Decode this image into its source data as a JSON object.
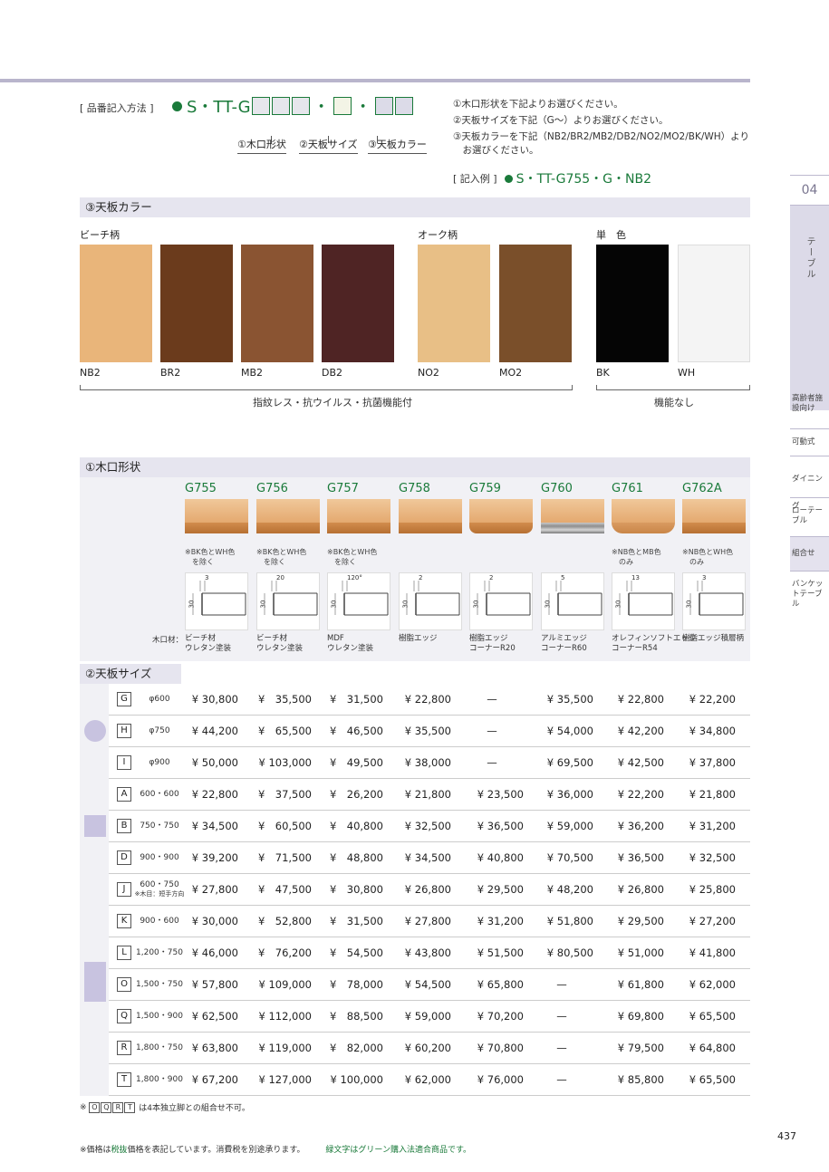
{
  "order": {
    "label": "[ 品番記入方法 ]",
    "code_prefix": "S・TT-G",
    "sep": "・",
    "part1": "①木口形状",
    "part2": "②天板サイズ",
    "part3": "③天板カラー"
  },
  "instructions": [
    "①木口形状を下記よりお選びください。",
    "②天板サイズを下記（G〜）よりお選びください。",
    "③天板カラーを下記（NB2/BR2/MB2/DB2/NO2/MO2/BK/WH）より",
    "　お選びください。"
  ],
  "example": {
    "label": "[ 記入例 ]",
    "code": "S・TT-G755・G・NB2"
  },
  "side": {
    "number": "04",
    "main": "テーブル",
    "items": [
      "高齢者施設向け",
      "可動式",
      "ダイニング",
      "ローテーブル",
      "組合せ",
      "バンケットテーブル"
    ]
  },
  "color_section": {
    "title": "③天板カラー",
    "groups": [
      "ビーチ柄",
      "オーク柄",
      "単　色"
    ],
    "swatches": [
      {
        "name": "NB2",
        "color": "#e9b57a"
      },
      {
        "name": "BR2",
        "color": "#6b3b1c"
      },
      {
        "name": "MB2",
        "color": "#8a5432"
      },
      {
        "name": "DB2",
        "color": "#4f2424"
      },
      {
        "name": "NO2",
        "color": "#e8bf86"
      },
      {
        "name": "MO2",
        "color": "#7a4f2a"
      },
      {
        "name": "BK",
        "color": "#050505"
      },
      {
        "name": "WH",
        "color": "#f4f4f4"
      }
    ],
    "feature1": "指紋レス・抗ウイルス・抗菌機能付",
    "feature2": "機能なし"
  },
  "edge_section": {
    "title": "①木口形状",
    "material_label": "木口材：",
    "edges": [
      {
        "code": "G755",
        "note": "※BK色とWH色\n　を除く",
        "dim": "3",
        "material": "ビーチ材\nウレタン塗装"
      },
      {
        "code": "G756",
        "note": "※BK色とWH色\n　を除く",
        "dim": "20",
        "material": "ビーチ材\nウレタン塗装"
      },
      {
        "code": "G757",
        "note": "※BK色とWH色\n　を除く",
        "dim": "120°",
        "material": "MDF\nウレタン塗装"
      },
      {
        "code": "G758",
        "note": "",
        "dim": "2",
        "material": "樹脂エッジ"
      },
      {
        "code": "G759",
        "note": "",
        "dim": "2",
        "material": "樹脂エッジ\nコーナーR20"
      },
      {
        "code": "G760",
        "note": "",
        "dim": "5",
        "material": "アルミエッジ\nコーナーR60"
      },
      {
        "code": "G761",
        "note": "※NB色とMB色\n　のみ",
        "dim": "13",
        "material": "オレフィンソフトエッジ\nコーナーR54"
      },
      {
        "code": "G762A",
        "note": "※NB色とWH色\n　のみ",
        "dim": "3",
        "material": "樹脂エッジ積層柄"
      }
    ],
    "height": "30"
  },
  "size_section": {
    "title": "②天板サイズ",
    "dash": "—",
    "rows": [
      {
        "code": "G",
        "size": "φ600",
        "prices": [
          "¥ 30,800",
          "¥　35,500",
          "¥　31,500",
          "¥ 22,800",
          "—",
          "¥ 35,500",
          "¥ 22,800",
          "¥ 22,200"
        ]
      },
      {
        "code": "H",
        "size": "φ750",
        "prices": [
          "¥ 44,200",
          "¥　65,500",
          "¥　46,500",
          "¥ 35,500",
          "—",
          "¥ 54,000",
          "¥ 42,200",
          "¥ 34,800"
        ]
      },
      {
        "code": "I",
        "size": "φ900",
        "prices": [
          "¥ 50,000",
          "¥ 103,000",
          "¥　49,500",
          "¥ 38,000",
          "—",
          "¥ 69,500",
          "¥ 42,500",
          "¥ 37,800"
        ]
      },
      {
        "code": "A",
        "size": "600・600",
        "prices": [
          "¥ 22,800",
          "¥　37,500",
          "¥　26,200",
          "¥ 21,800",
          "¥ 23,500",
          "¥ 36,000",
          "¥ 22,200",
          "¥ 21,800"
        ]
      },
      {
        "code": "B",
        "size": "750・750",
        "prices": [
          "¥ 34,500",
          "¥　60,500",
          "¥　40,800",
          "¥ 32,500",
          "¥ 36,500",
          "¥ 59,000",
          "¥ 36,200",
          "¥ 31,200"
        ]
      },
      {
        "code": "D",
        "size": "900・900",
        "prices": [
          "¥ 39,200",
          "¥　71,500",
          "¥　48,800",
          "¥ 34,500",
          "¥ 40,800",
          "¥ 70,500",
          "¥ 36,500",
          "¥ 32,500"
        ]
      },
      {
        "code": "J",
        "size": "600・750",
        "size_note": "※木目：短手方向",
        "prices": [
          "¥ 27,800",
          "¥　47,500",
          "¥　30,800",
          "¥ 26,800",
          "¥ 29,500",
          "¥ 48,200",
          "¥ 26,800",
          "¥ 25,800"
        ]
      },
      {
        "code": "K",
        "size": "900・600",
        "prices": [
          "¥ 30,000",
          "¥　52,800",
          "¥　31,500",
          "¥ 27,800",
          "¥ 31,200",
          "¥ 51,800",
          "¥ 29,500",
          "¥ 27,200"
        ]
      },
      {
        "code": "L",
        "size": "1,200・750",
        "prices": [
          "¥ 46,000",
          "¥　76,200",
          "¥　54,500",
          "¥ 43,800",
          "¥ 51,500",
          "¥ 80,500",
          "¥ 51,000",
          "¥ 41,800"
        ]
      },
      {
        "code": "O",
        "size": "1,500・750",
        "prices": [
          "¥ 57,800",
          "¥ 109,000",
          "¥　78,000",
          "¥ 54,500",
          "¥ 65,800",
          "—",
          "¥ 61,800",
          "¥ 62,000"
        ]
      },
      {
        "code": "Q",
        "size": "1,500・900",
        "prices": [
          "¥ 62,500",
          "¥ 112,000",
          "¥　88,500",
          "¥ 59,000",
          "¥ 70,200",
          "—",
          "¥ 69,800",
          "¥ 65,500"
        ]
      },
      {
        "code": "R",
        "size": "1,800・750",
        "prices": [
          "¥ 63,800",
          "¥ 119,000",
          "¥　82,000",
          "¥ 60,200",
          "¥ 70,800",
          "—",
          "¥ 79,500",
          "¥ 64,800"
        ]
      },
      {
        "code": "T",
        "size": "1,800・900",
        "prices": [
          "¥ 67,200",
          "¥ 127,000",
          "¥ 100,000",
          "¥ 62,000",
          "¥ 76,000",
          "—",
          "¥ 85,800",
          "¥ 65,500"
        ]
      }
    ]
  },
  "footnote": {
    "prefix": "※",
    "codes": [
      "O",
      "Q",
      "R",
      "T"
    ],
    "text": "は4本独立脚との組合せ不可。"
  },
  "bottom": {
    "text1": "※価格は",
    "text2": "税抜",
    "text3": "価格を表記しています。消費税を別途承ります。",
    "green": "緑文字はグリーン購入法適合商品です。"
  },
  "page_number": "437",
  "colors": {
    "green": "#1a7a3a",
    "lavender": "#c8c3e0",
    "header_bg": "#e6e5ef"
  }
}
